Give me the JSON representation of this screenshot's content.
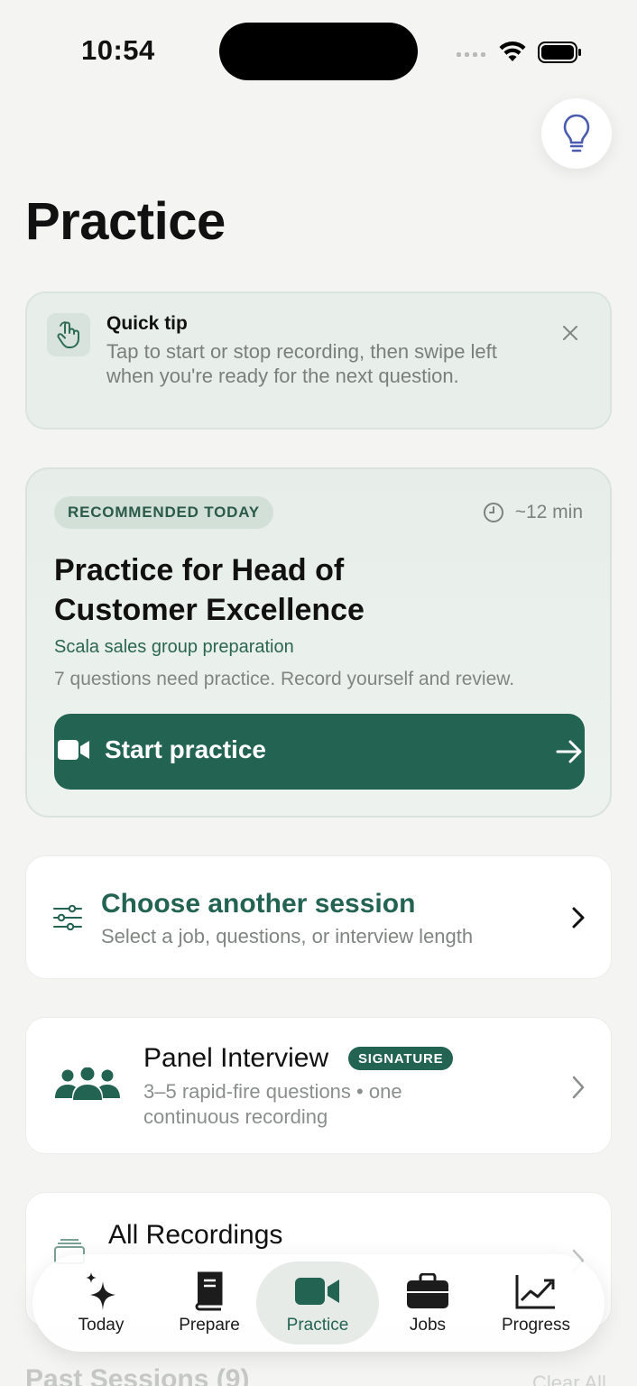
{
  "status_bar": {
    "time": "10:54"
  },
  "page": {
    "title": "Practice"
  },
  "quick_tip": {
    "title": "Quick tip",
    "body": "Tap to start or stop recording, then swipe left when you're ready for the next question."
  },
  "recommended": {
    "badge": "RECOMMENDED TODAY",
    "duration": "~12 min",
    "title": "Practice for Head of Customer Excellence",
    "subtitle": "Scala sales group preparation",
    "description": "7 questions need practice. Record yourself and review.",
    "button_label": "Start practice"
  },
  "choose_session": {
    "title": "Choose another session",
    "subtitle": "Select a job, questions, or interview length"
  },
  "panel_interview": {
    "title": "Panel Interview",
    "badge": "SIGNATURE",
    "subtitle": "3–5 rapid-fire questions • one continuous recording"
  },
  "all_recordings": {
    "title": "All Recordings"
  },
  "past_sessions": {
    "title": "Past Sessions (9)",
    "clear_label": "Clear All"
  },
  "tabs": [
    {
      "label": "Today",
      "icon": "sparkles-icon"
    },
    {
      "label": "Prepare",
      "icon": "book-icon"
    },
    {
      "label": "Practice",
      "icon": "video-camera-icon",
      "active": true
    },
    {
      "label": "Jobs",
      "icon": "briefcase-icon"
    },
    {
      "label": "Progress",
      "icon": "chart-line-icon"
    }
  ],
  "colors": {
    "accent": "#236352",
    "background": "#f4f4f2",
    "card_tint": "#e8eeea",
    "hint_icon": "#4a5bb0"
  }
}
